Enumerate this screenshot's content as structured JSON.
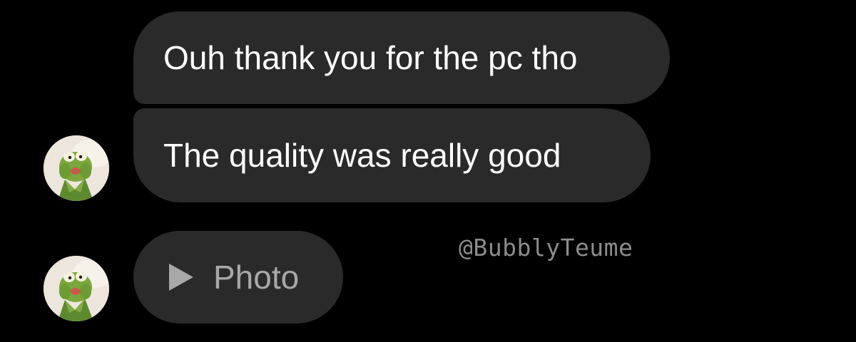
{
  "messages": [
    {
      "text": "Ouh thank you for the pc tho"
    },
    {
      "text": "The quality was really good"
    },
    {
      "text": "Photo",
      "icon": "play-icon"
    }
  ],
  "avatar": {
    "icon": "kermit-frog-avatar"
  },
  "watermark": "@BubblyTeume",
  "colors": {
    "background": "#000000",
    "bubble": "#2a2a2a",
    "text": "#ffffff",
    "muted_text": "#a8a8a8",
    "watermark": "#8c8c8c"
  }
}
